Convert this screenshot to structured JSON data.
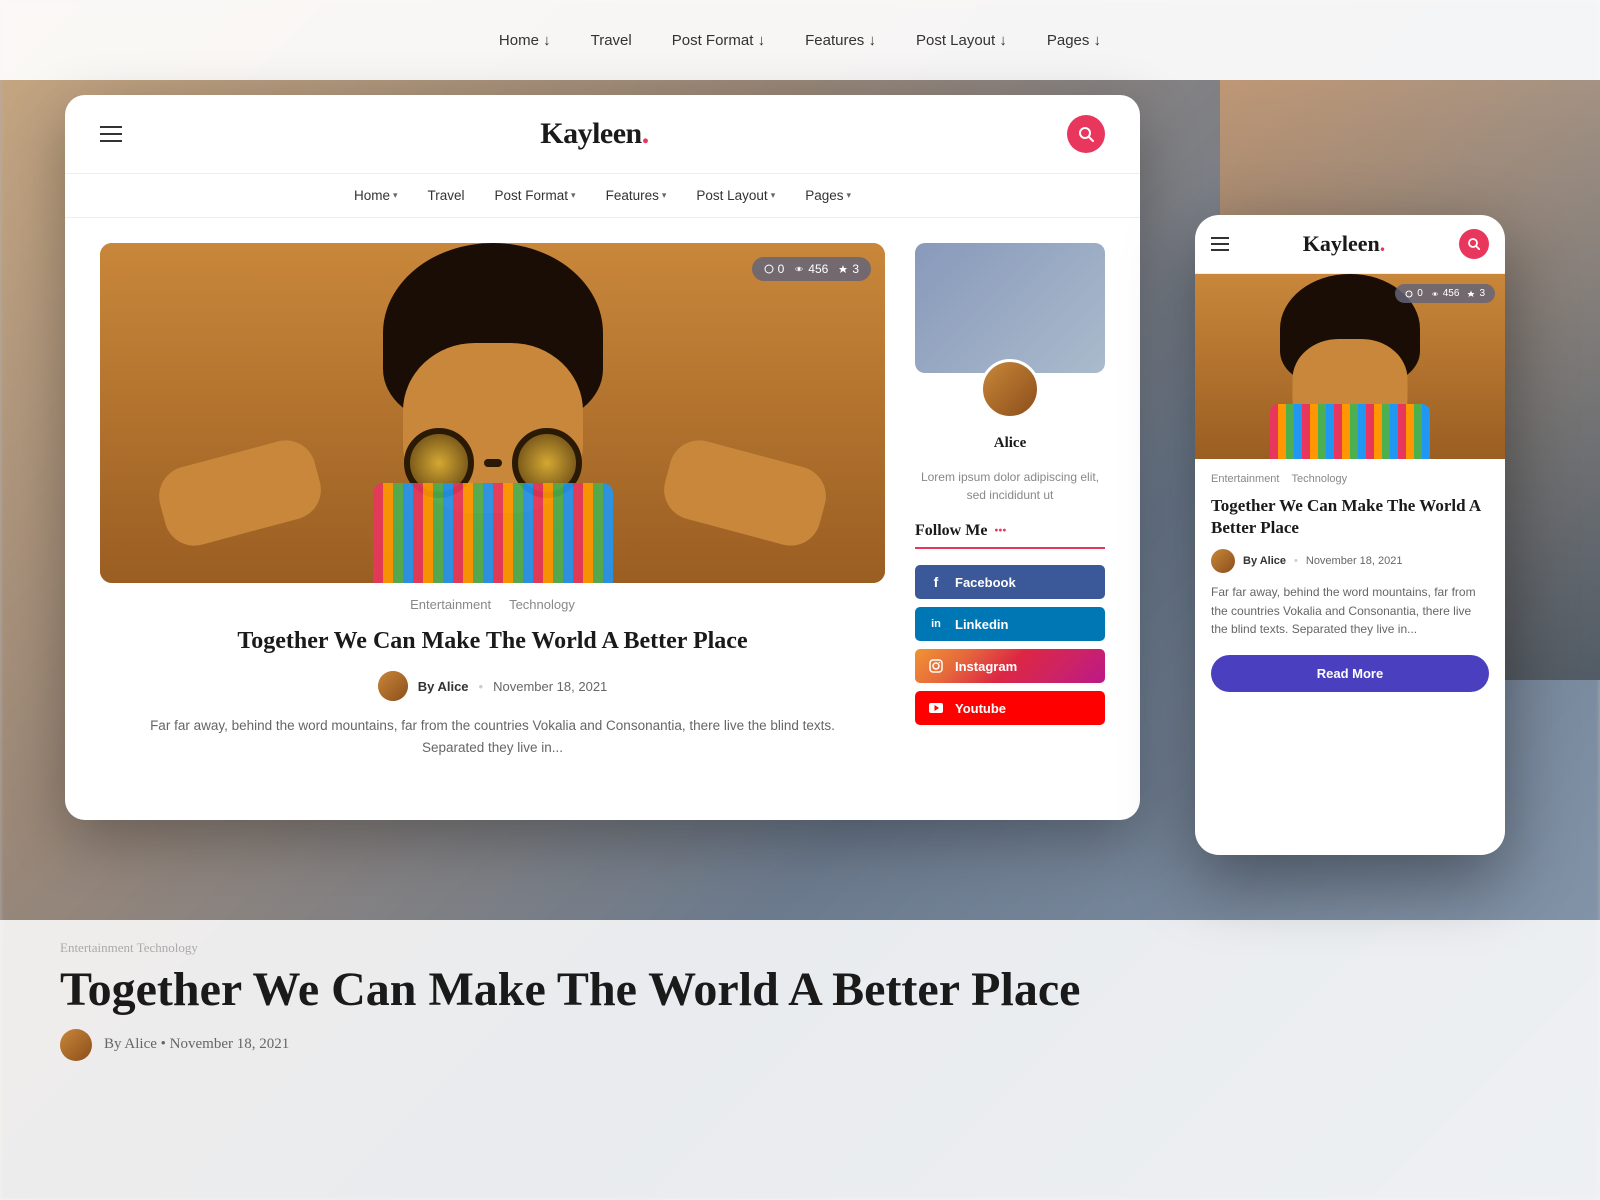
{
  "background": {
    "nav_items": [
      "Home ↓",
      "Travel",
      "Post Format ↓",
      "Features ↓",
      "Post Layout ↓",
      "Pages ↓"
    ]
  },
  "desktop": {
    "logo": "Kayleen",
    "logo_dot": ".",
    "nav_items": [
      {
        "label": "Home",
        "has_dropdown": true
      },
      {
        "label": "Travel",
        "has_dropdown": false
      },
      {
        "label": "Post Format",
        "has_dropdown": true
      },
      {
        "label": "Features",
        "has_dropdown": true
      },
      {
        "label": "Post Layout",
        "has_dropdown": true
      },
      {
        "label": "Pages",
        "has_dropdown": true
      }
    ],
    "article": {
      "stats": {
        "comments": "0",
        "views": "456",
        "rating": "3"
      },
      "categories": [
        "Entertainment",
        "Technology"
      ],
      "title": "Together We Can Make The World A Better Place",
      "author": "By Alice",
      "date": "November 18, 2021",
      "excerpt": "Far far away, behind the word mountains, far from the countries Vokalia and Consonantia, there live the blind texts. Separated they live in..."
    },
    "sidebar": {
      "author_name": "Alice",
      "sidebar_excerpt": "Lorem ipsum dolor adipiscing elit, sed incididunt ut",
      "follow_me_label": "Follow Me",
      "social_links": [
        {
          "platform": "Facebook",
          "label": "Facebook"
        },
        {
          "platform": "Linkedin",
          "label": "Linkedin"
        },
        {
          "platform": "Instagram",
          "label": "Instagram"
        },
        {
          "platform": "Youtube",
          "label": "Youtube"
        }
      ]
    }
  },
  "mobile": {
    "logo": "Kayleen",
    "logo_dot": ".",
    "article": {
      "stats": {
        "comments": "0",
        "views": "456",
        "rating": "3"
      },
      "categories": [
        "Entertainment",
        "Technology"
      ],
      "title": "Together We Can Make The World A Better Place",
      "author": "By Alice",
      "date": "November 18, 2021",
      "excerpt": "Far far away, behind the word mountains, far from the countries Vokalia and Consonantia, there live the blind texts. Separated they live in...",
      "read_more_label": "Read More"
    }
  },
  "bg_bottom": {
    "tags": "Entertainment   Technology",
    "title": "Together We Can Make The World A Better Place",
    "meta": "By Alice  •  November 18, 2021"
  }
}
